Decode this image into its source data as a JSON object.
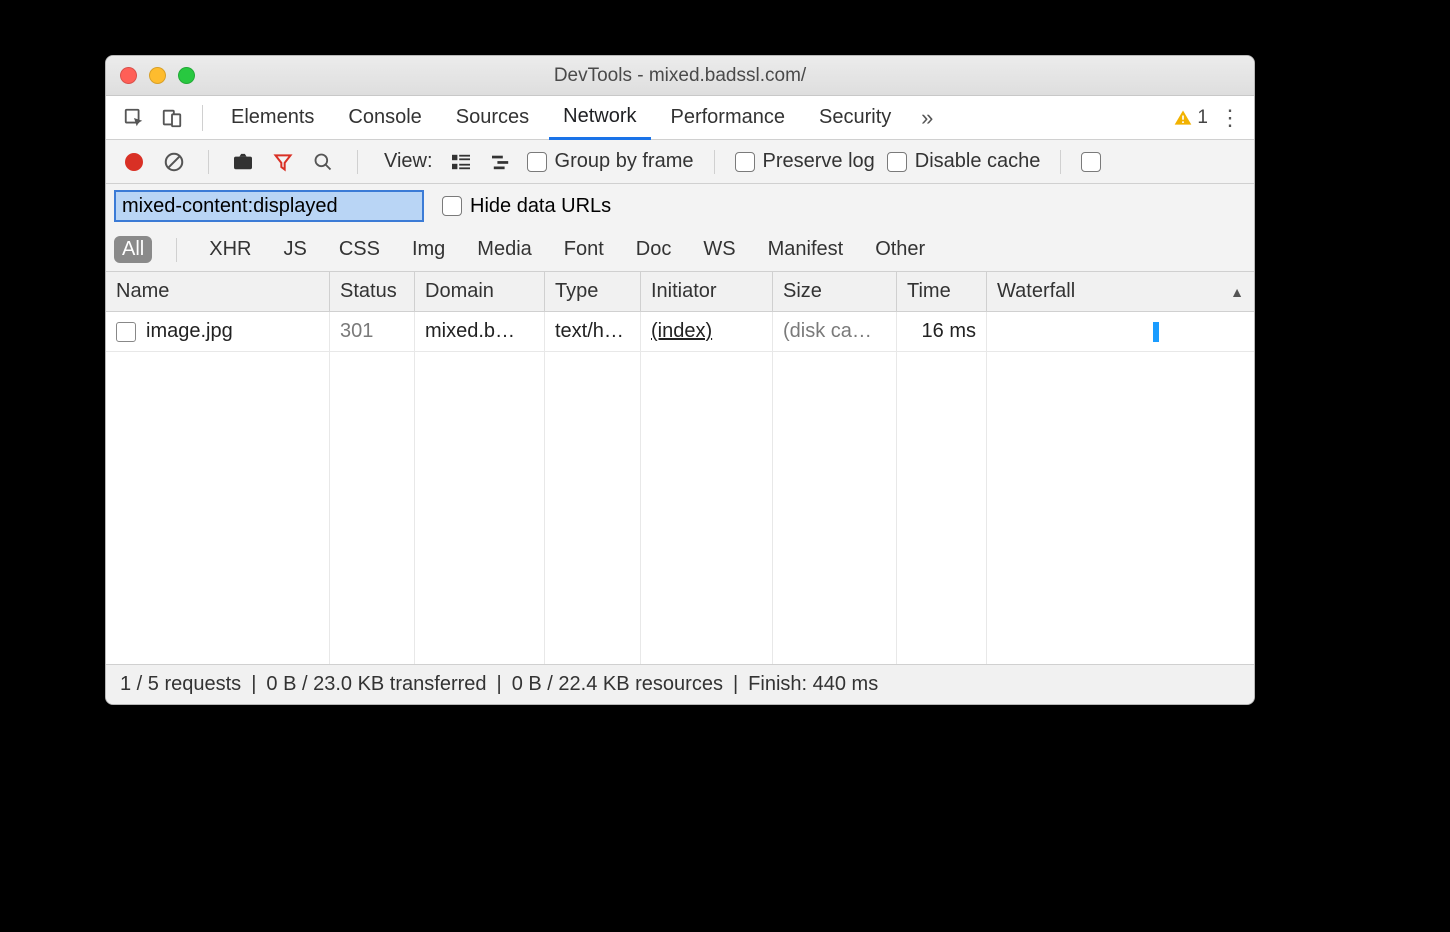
{
  "window": {
    "title": "DevTools - mixed.badssl.com/"
  },
  "tabs": {
    "items": [
      "Elements",
      "Console",
      "Sources",
      "Network",
      "Performance",
      "Security"
    ],
    "active_index": 3,
    "overflow_glyph": "»",
    "warning_count": "1"
  },
  "toolbar": {
    "view_label": "View:",
    "group_by_frame": "Group by frame",
    "preserve_log": "Preserve log",
    "disable_cache": "Disable cache"
  },
  "filter": {
    "value": "mixed-content:displayed",
    "hide_data_urls": "Hide data URLs"
  },
  "type_filters": {
    "items": [
      "All",
      "XHR",
      "JS",
      "CSS",
      "Img",
      "Media",
      "Font",
      "Doc",
      "WS",
      "Manifest",
      "Other"
    ],
    "active_index": 0
  },
  "columns": {
    "name": "Name",
    "status": "Status",
    "domain": "Domain",
    "type": "Type",
    "initiator": "Initiator",
    "size": "Size",
    "time": "Time",
    "waterfall": "Waterfall"
  },
  "rows": [
    {
      "name": "image.jpg",
      "status": "301",
      "domain": "mixed.b…",
      "type": "text/h…",
      "initiator": "(index)",
      "size": "(disk ca…",
      "time": "16 ms",
      "wf_left_pct": 62,
      "wf_width_pct": 2.5
    }
  ],
  "status": {
    "requests": "1 / 5 requests",
    "transferred": "0 B / 23.0 KB transferred",
    "resources": "0 B / 22.4 KB resources",
    "finish": "Finish: 440 ms"
  }
}
